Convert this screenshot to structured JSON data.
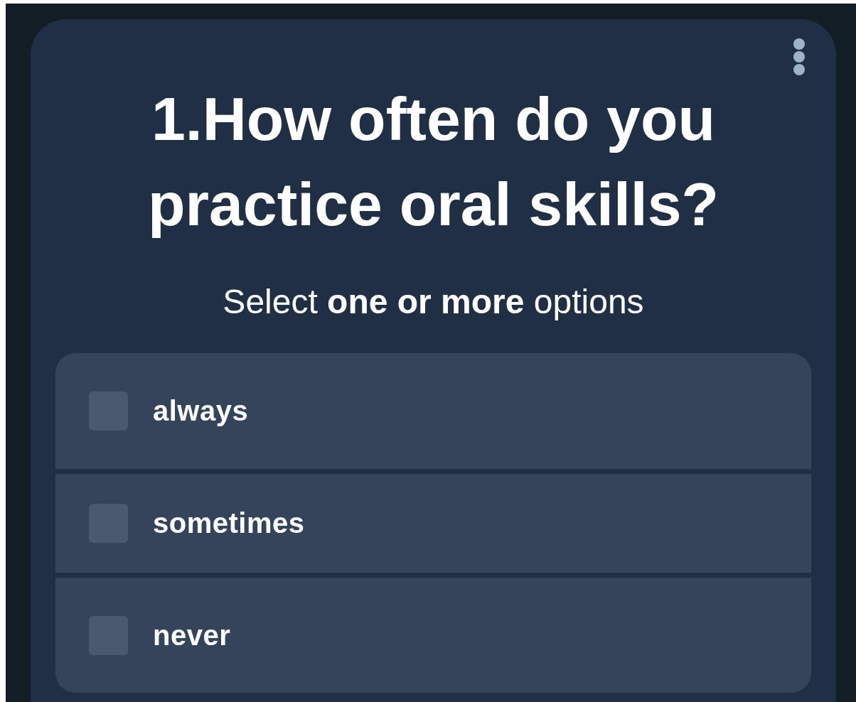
{
  "question": {
    "title": "1.How often do you practice oral skills?",
    "instruction": "Select **one or more** options"
  },
  "options": [
    {
      "label": "always",
      "checked": false
    },
    {
      "label": "sometimes",
      "checked": false
    },
    {
      "label": "never",
      "checked": false
    }
  ]
}
